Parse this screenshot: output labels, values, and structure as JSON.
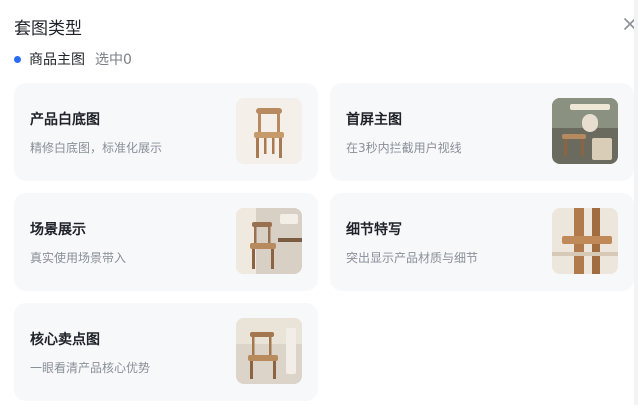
{
  "dialog": {
    "title": "套图类型"
  },
  "section": {
    "label": "商品主图",
    "selected": "选中0"
  },
  "cards": [
    {
      "title": "产品白底图",
      "desc": "精修白底图，标准化展示",
      "icon": "chair-white-bg-thumb"
    },
    {
      "title": "首屏主图",
      "desc": "在3秒内拦截用户视线",
      "icon": "chair-lifestyle-thumb"
    },
    {
      "title": "场景展示",
      "desc": "真实使用场景带入",
      "icon": "chair-scene-thumb"
    },
    {
      "title": "细节特写",
      "desc": "突出显示产品材质与细节",
      "icon": "chair-detail-thumb"
    },
    {
      "title": "核心卖点图",
      "desc": "一眼看清产品核心优势",
      "icon": "chair-selling-point-thumb"
    }
  ],
  "colors": {
    "accent": "#2b6cf6",
    "card_bg": "#f7f8fa",
    "muted_text": "#8a8f98"
  }
}
